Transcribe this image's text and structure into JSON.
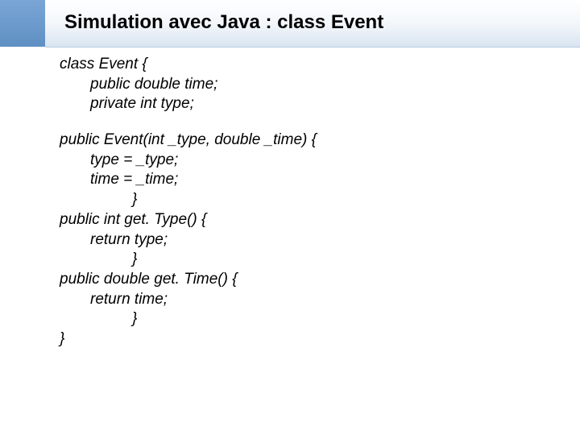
{
  "title": "Simulation avec Java : class Event",
  "code": {
    "l01": "class Event {",
    "l02": "public double time;",
    "l03": "private int type;",
    "l04": "public Event(int  _type, double  _time) {",
    "l05": "type = _type;",
    "l06": "time = _time;",
    "l07": "}",
    "l08": "public int get. Type() {",
    "l09": "return type;",
    "l10": "}",
    "l11": "public double get. Time() {",
    "l12": "return time;",
    "l13": "}",
    "l14": "}"
  }
}
